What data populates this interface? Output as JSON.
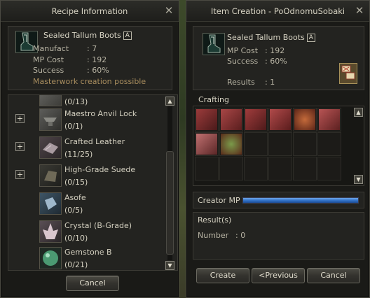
{
  "recipe_window": {
    "title": "Recipe Information",
    "item_name": "Sealed Tallum Boots",
    "badge": "A",
    "manufact_label": "Manufact",
    "manufact_value": ":  7",
    "mp_label": "MP Cost",
    "mp_value": ":  192",
    "success_label": "Success",
    "success_value": ":  60%",
    "masterwork": "Masterwork creation possible",
    "materials": [
      {
        "name": "",
        "count": "(0/13)",
        "expandable": false,
        "icon": "partial-item-icon"
      },
      {
        "name": "Maestro Anvil Lock",
        "count": "(0/1)",
        "expandable": true,
        "icon": "anvil-lock-icon"
      },
      {
        "name": "Crafted Leather",
        "count": "(11/25)",
        "expandable": true,
        "icon": "leather-icon"
      },
      {
        "name": "High-Grade Suede",
        "count": "(0/15)",
        "expandable": true,
        "icon": "suede-icon"
      },
      {
        "name": "Asofe",
        "count": "(0/5)",
        "expandable": false,
        "icon": "asofe-icon"
      },
      {
        "name": "Crystal (B-Grade)",
        "count": "(0/10)",
        "expandable": false,
        "icon": "crystal-icon"
      },
      {
        "name": "Gemstone B",
        "count": "(0/21)",
        "expandable": false,
        "icon": "gemstone-icon"
      }
    ],
    "cancel_label": "Cancel"
  },
  "creation_window": {
    "title": "Item Creation - PoOdnomuSobaki",
    "item_name": "Sealed Tallum Boots",
    "badge": "A",
    "mp_label": "MP Cost",
    "mp_value": ":  192",
    "success_label": "Success",
    "success_value": ":  60%",
    "results_label": "Results",
    "results_value": ":  1",
    "crafting_label": "Crafting",
    "crafting_icons": [
      "tallum-boots-icon",
      "leather-icon",
      "anvil-lock-icon",
      "asofe-icon",
      "gemstone-pouch-icon",
      "suede-icon",
      "crystal-icon",
      "gemstone-icon"
    ],
    "creator_mp_label": "Creator MP",
    "creator_mp_fill": 1.0,
    "result_label": "Result(s)",
    "number_label": "Number",
    "number_value": ":  0",
    "create_label": "Create",
    "previous_label": "<Previous",
    "cancel_label": "Cancel"
  },
  "colors": {
    "mp_bar": "#2f6fc4",
    "gold_text": "#a88d5e"
  }
}
